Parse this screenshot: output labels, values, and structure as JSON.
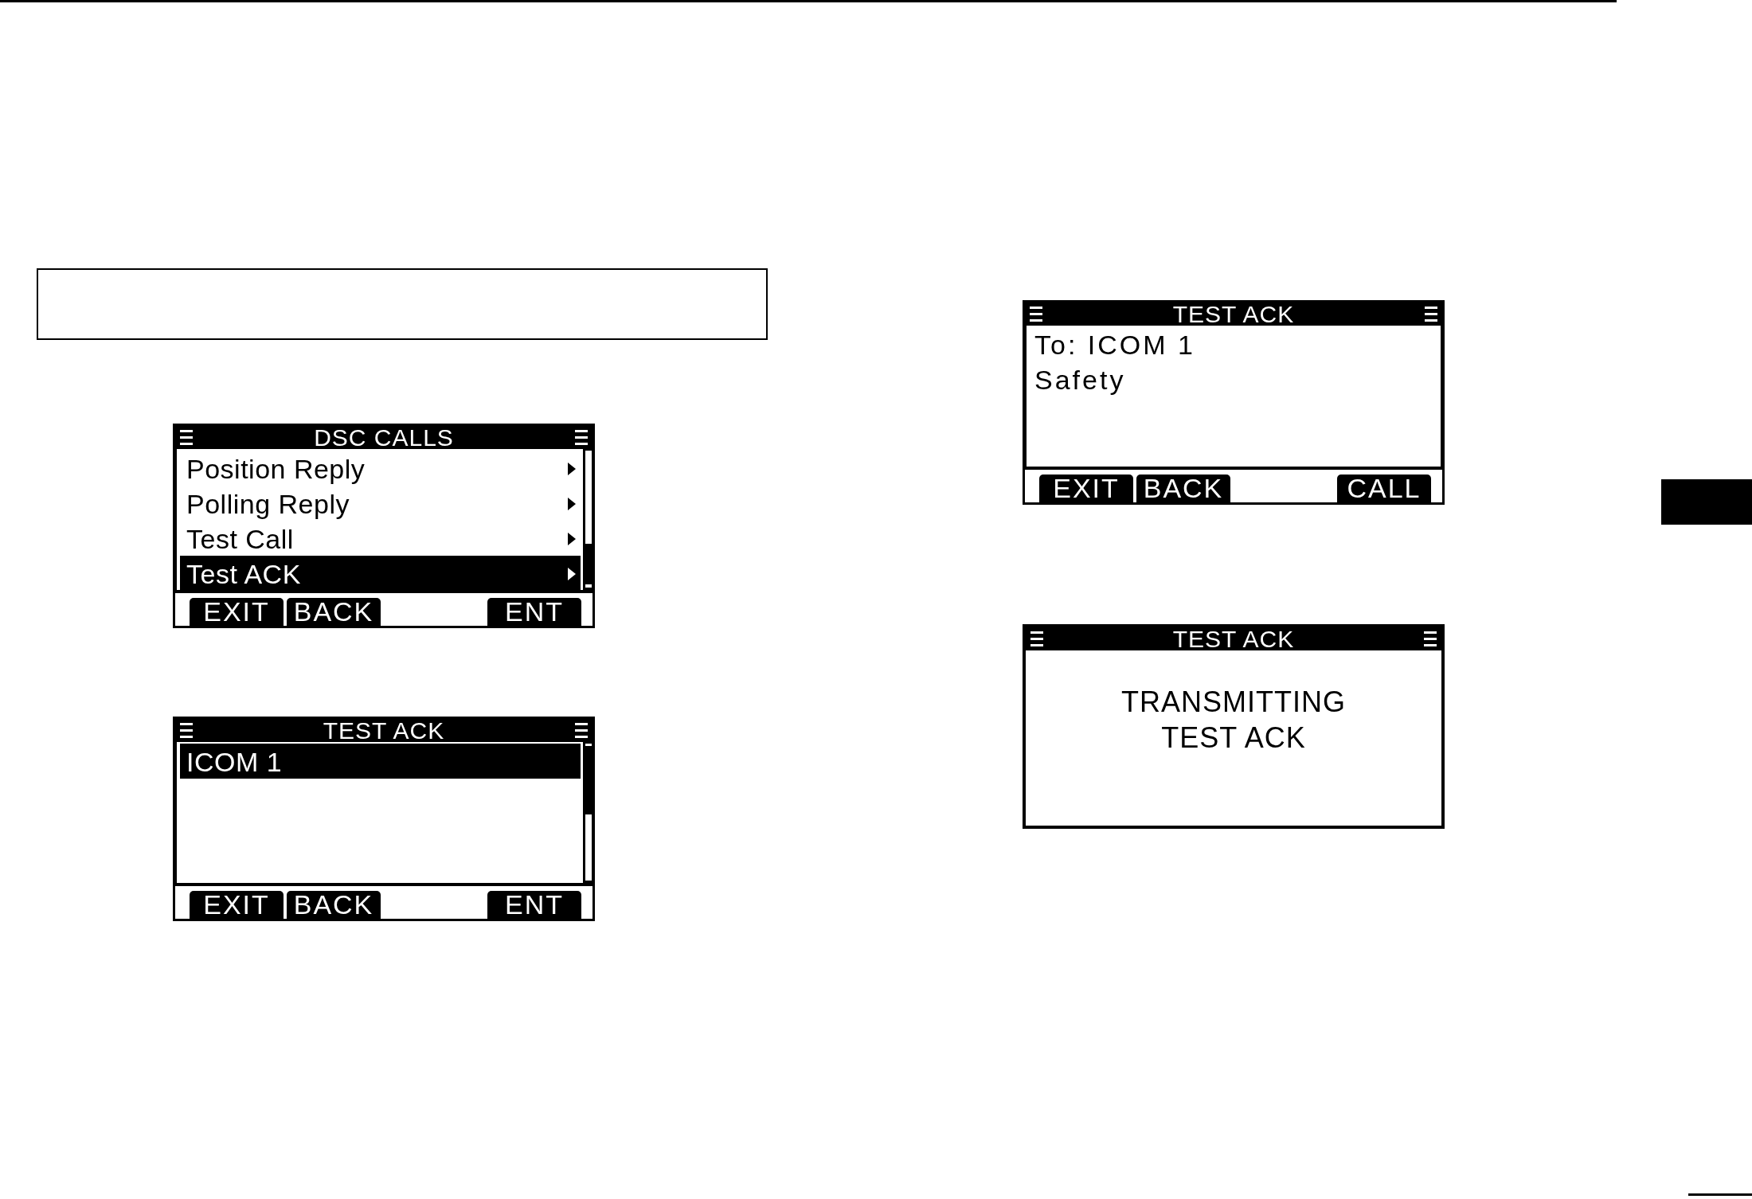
{
  "left_column": {
    "screens": [
      {
        "kind": "menu",
        "title": "DSC CALLS",
        "items": [
          {
            "label": "Position Reply",
            "selected": false,
            "submenu": true
          },
          {
            "label": "Polling Reply",
            "selected": false,
            "submenu": true
          },
          {
            "label": "Test Call",
            "selected": false,
            "submenu": true
          },
          {
            "label": "Test ACK",
            "selected": true,
            "submenu": true
          }
        ],
        "softkeys": [
          "EXIT",
          "BACK",
          "ENT"
        ]
      },
      {
        "kind": "menu",
        "title": "TEST ACK",
        "items": [
          {
            "label": "ICOM 1",
            "selected": true,
            "submenu": false
          }
        ],
        "softkeys": [
          "EXIT",
          "BACK",
          "ENT"
        ]
      }
    ]
  },
  "right_column": {
    "screens": [
      {
        "kind": "message",
        "title": "TEST ACK",
        "lines": [
          "To: ICOM 1",
          "Safety"
        ],
        "softkeys": [
          "EXIT",
          "BACK",
          "CALL"
        ]
      },
      {
        "kind": "status",
        "title": "TEST ACK",
        "lines": [
          "TRANSMITTING",
          "TEST ACK"
        ]
      }
    ]
  }
}
